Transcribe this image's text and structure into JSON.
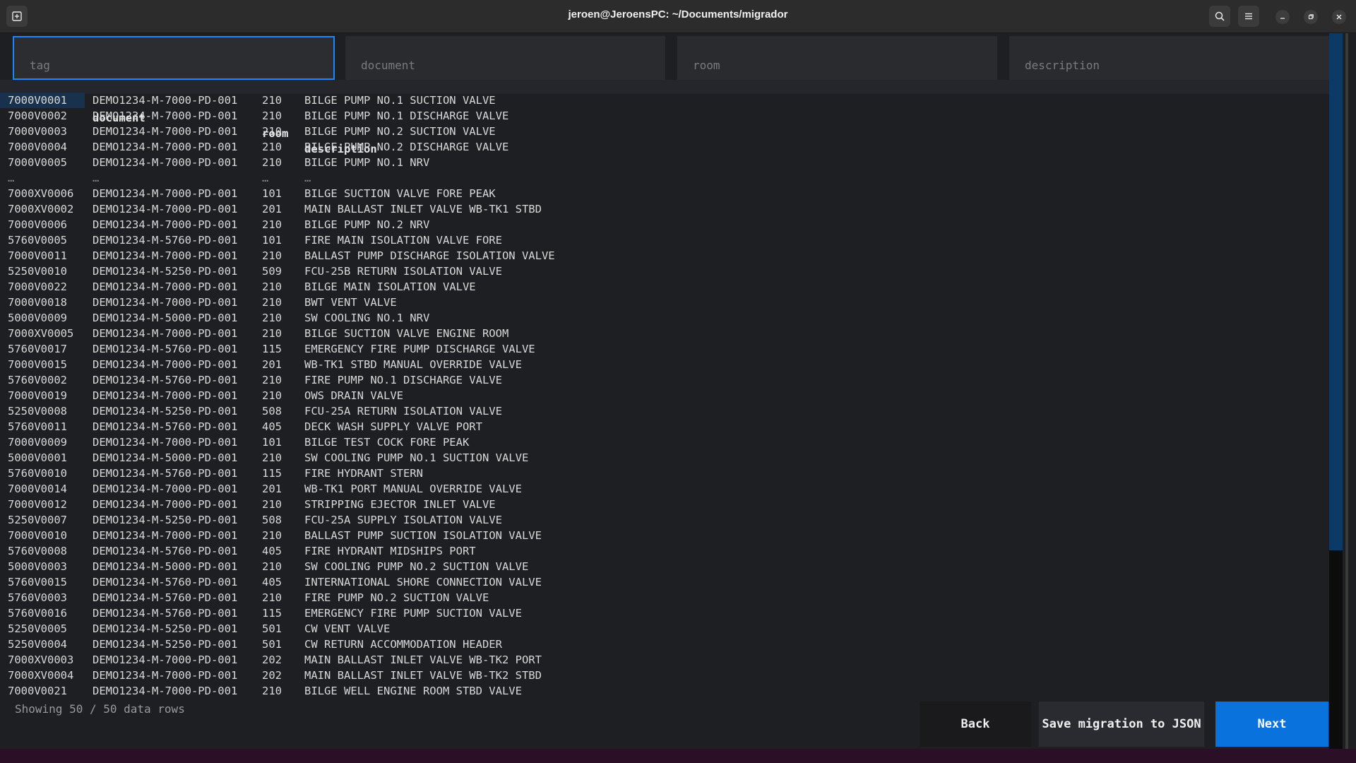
{
  "window": {
    "title": "jeroen@JeroensPC: ~/Documents/migrador"
  },
  "filters": {
    "tag": "tag",
    "document": "document",
    "room": "room",
    "description": "description"
  },
  "columns": [
    "tag",
    "document",
    "room",
    "description"
  ],
  "rows": [
    [
      "7000V0001",
      "DEMO1234-M-7000-PD-001",
      "210",
      "BILGE PUMP NO.1 SUCTION VALVE"
    ],
    [
      "7000V0002",
      "DEMO1234-M-7000-PD-001",
      "210",
      "BILGE PUMP NO.1 DISCHARGE VALVE"
    ],
    [
      "7000V0003",
      "DEMO1234-M-7000-PD-001",
      "210",
      "BILGE PUMP NO.2 SUCTION VALVE"
    ],
    [
      "7000V0004",
      "DEMO1234-M-7000-PD-001",
      "210",
      "BILGE PUMP NO.2 DISCHARGE VALVE"
    ],
    [
      "7000V0005",
      "DEMO1234-M-7000-PD-001",
      "210",
      "BILGE PUMP NO.1 NRV"
    ],
    [
      "…",
      "…",
      "…",
      "…"
    ],
    [
      "7000XV0006",
      "DEMO1234-M-7000-PD-001",
      "101",
      "BILGE SUCTION VALVE FORE PEAK"
    ],
    [
      "7000XV0002",
      "DEMO1234-M-7000-PD-001",
      "201",
      "MAIN BALLAST INLET VALVE WB-TK1 STBD"
    ],
    [
      "7000V0006",
      "DEMO1234-M-7000-PD-001",
      "210",
      "BILGE PUMP NO.2 NRV"
    ],
    [
      "5760V0005",
      "DEMO1234-M-5760-PD-001",
      "101",
      "FIRE MAIN ISOLATION VALVE FORE"
    ],
    [
      "7000V0011",
      "DEMO1234-M-7000-PD-001",
      "210",
      "BALLAST PUMP DISCHARGE ISOLATION VALVE"
    ],
    [
      "5250V0010",
      "DEMO1234-M-5250-PD-001",
      "509",
      "FCU-25B RETURN ISOLATION VALVE"
    ],
    [
      "7000V0022",
      "DEMO1234-M-7000-PD-001",
      "210",
      "BILGE MAIN ISOLATION VALVE"
    ],
    [
      "7000V0018",
      "DEMO1234-M-7000-PD-001",
      "210",
      "BWT VENT VALVE"
    ],
    [
      "5000V0009",
      "DEMO1234-M-5000-PD-001",
      "210",
      "SW COOLING NO.1 NRV"
    ],
    [
      "7000XV0005",
      "DEMO1234-M-7000-PD-001",
      "210",
      "BILGE SUCTION VALVE ENGINE ROOM"
    ],
    [
      "5760V0017",
      "DEMO1234-M-5760-PD-001",
      "115",
      "EMERGENCY FIRE PUMP DISCHARGE VALVE"
    ],
    [
      "7000V0015",
      "DEMO1234-M-7000-PD-001",
      "201",
      "WB-TK1 STBD MANUAL OVERRIDE VALVE"
    ],
    [
      "5760V0002",
      "DEMO1234-M-5760-PD-001",
      "210",
      "FIRE PUMP NO.1 DISCHARGE VALVE"
    ],
    [
      "7000V0019",
      "DEMO1234-M-7000-PD-001",
      "210",
      "OWS DRAIN VALVE"
    ],
    [
      "5250V0008",
      "DEMO1234-M-5250-PD-001",
      "508",
      "FCU-25A RETURN ISOLATION VALVE"
    ],
    [
      "5760V0011",
      "DEMO1234-M-5760-PD-001",
      "405",
      "DECK WASH SUPPLY VALVE PORT"
    ],
    [
      "7000V0009",
      "DEMO1234-M-7000-PD-001",
      "101",
      "BILGE TEST COCK FORE PEAK"
    ],
    [
      "5000V0001",
      "DEMO1234-M-5000-PD-001",
      "210",
      "SW COOLING PUMP NO.1 SUCTION VALVE"
    ],
    [
      "5760V0010",
      "DEMO1234-M-5760-PD-001",
      "115",
      "FIRE HYDRANT STERN"
    ],
    [
      "7000V0014",
      "DEMO1234-M-7000-PD-001",
      "201",
      "WB-TK1 PORT MANUAL OVERRIDE VALVE"
    ],
    [
      "7000V0012",
      "DEMO1234-M-7000-PD-001",
      "210",
      "STRIPPING EJECTOR INLET VALVE"
    ],
    [
      "5250V0007",
      "DEMO1234-M-5250-PD-001",
      "508",
      "FCU-25A SUPPLY ISOLATION VALVE"
    ],
    [
      "7000V0010",
      "DEMO1234-M-7000-PD-001",
      "210",
      "BALLAST PUMP SUCTION ISOLATION VALVE"
    ],
    [
      "5760V0008",
      "DEMO1234-M-5760-PD-001",
      "405",
      "FIRE HYDRANT MIDSHIPS PORT"
    ],
    [
      "5000V0003",
      "DEMO1234-M-5000-PD-001",
      "210",
      "SW COOLING PUMP NO.2 SUCTION VALVE"
    ],
    [
      "5760V0015",
      "DEMO1234-M-5760-PD-001",
      "405",
      "INTERNATIONAL SHORE CONNECTION VALVE"
    ],
    [
      "5760V0003",
      "DEMO1234-M-5760-PD-001",
      "210",
      "FIRE PUMP NO.2 SUCTION VALVE"
    ],
    [
      "5760V0016",
      "DEMO1234-M-5760-PD-001",
      "115",
      "EMERGENCY FIRE PUMP SUCTION VALVE"
    ],
    [
      "5250V0005",
      "DEMO1234-M-5250-PD-001",
      "501",
      "CW VENT VALVE"
    ],
    [
      "5250V0004",
      "DEMO1234-M-5250-PD-001",
      "501",
      "CW RETURN ACCOMMODATION HEADER"
    ],
    [
      "7000XV0003",
      "DEMO1234-M-7000-PD-001",
      "202",
      "MAIN BALLAST INLET VALVE WB-TK2 PORT"
    ],
    [
      "7000XV0004",
      "DEMO1234-M-7000-PD-001",
      "202",
      "MAIN BALLAST INLET VALVE WB-TK2 STBD"
    ],
    [
      "7000V0021",
      "DEMO1234-M-7000-PD-001",
      "210",
      "BILGE WELL ENGINE ROOM STBD VALVE"
    ]
  ],
  "status": "Showing 50 / 50 data rows",
  "buttons": {
    "back": "Back",
    "save": "Save migration to JSON",
    "next": "Next"
  },
  "colors": {
    "accent": "#0a72dc",
    "focus_border": "#1a86ff",
    "selection": "#18324d"
  },
  "icons": {
    "new_tab": "new-tab-icon",
    "search": "search-icon",
    "menu": "hamburger-menu-icon",
    "minimize": "minimize-icon",
    "maximize": "maximize-icon",
    "close": "close-icon"
  }
}
